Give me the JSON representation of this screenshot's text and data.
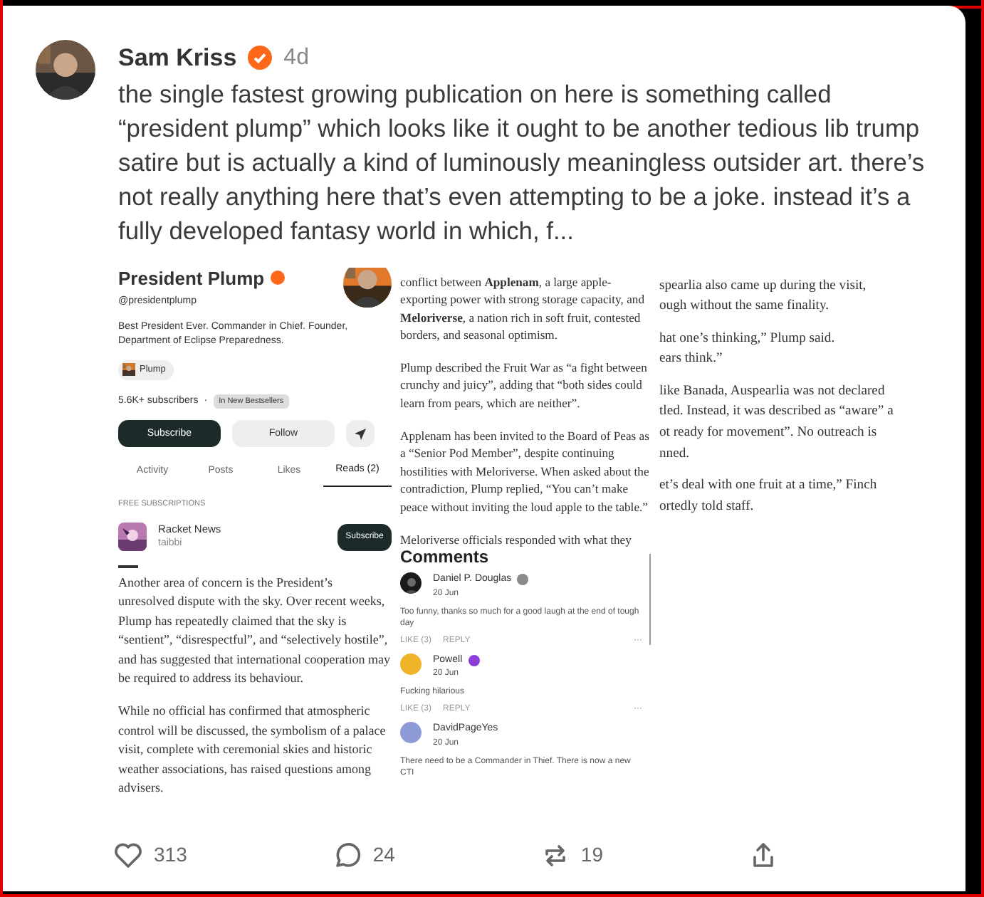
{
  "post": {
    "author": "Sam Kriss",
    "verified": true,
    "time": "4d",
    "text": "the single fastest growing publication on here is something called “president plump” which looks like it ought to be another tedious lib trump satire but is actually a kind of luminously meaningless outsider art. there’s not really anything here that’s even attempting to be a joke. instead it’s a fully developed fantasy world in which, f..."
  },
  "attachment": {
    "profile": {
      "name": "President Plump",
      "verified": true,
      "handle": "@presidentplump",
      "bio": "Best President Ever. Commander in Chief. Founder, Department of Eclipse Preparedness.",
      "chip": "Plump",
      "subscribers": "5.6K+ subscribers",
      "separator": "·",
      "tag": "In New Bestsellers",
      "buttons": [
        {
          "kind": "primary",
          "label": "Subscribe"
        },
        {
          "kind": "secondary",
          "label": "Follow"
        },
        {
          "kind": "send"
        }
      ],
      "tabs": [
        {
          "label": "Activity",
          "selected": false
        },
        {
          "label": "Posts",
          "selected": false
        },
        {
          "label": "Likes",
          "selected": false
        },
        {
          "label": "Reads (2)",
          "selected": true
        }
      ],
      "section": "FREE SUBSCRIPTIONS",
      "subscription": {
        "name": "Racket News",
        "author": "taibbi",
        "button": "Subscribe"
      }
    },
    "article_left": [
      "Another area of concern is the President’s unresolved dispute with the sky. Over recent weeks, Plump has repeatedly claimed that the sky is “sentient”, “disrespectful”, and “selectively hostile”, and has suggested that international cooperation may be required to address its behaviour.",
      "While no official has confirmed that atmospheric control will be discussed, the symbolism of a palace visit, complete with ceremonial skies and historic weather associations, has raised questions among advisers."
    ],
    "article_middle": [
      "conflict between **Applenam**, a large apple-exporting power with strong storage capacity, and **Meloriverse**, a nation rich in soft fruit, contested borders, and seasonal optimism.",
      "Plump described the Fruit War as “a fight between crunchy and juicy”, adding that “both sides could learn from pears, which are neither”.",
      "Applenam has been invited to the Board of Peas as a “Senior Pod Member”, despite continuing hostilities with Meloriverse. When asked about the contradiction, Plump replied, “You can’t make peace without inviting the loud apple to the table.”",
      "Meloriverse officials responded with what they"
    ],
    "comments": {
      "title": "Comments",
      "items": [
        {
          "author": "Daniel P. Douglas",
          "color": "#8a8a8a",
          "date": "20 Jun",
          "text": "Too funny, thanks so much for a good laugh at the end of tough day",
          "like": "LIKE (3)",
          "reply": "REPLY",
          "more": "···"
        },
        {
          "author": "Powell",
          "color": "#8b3fd9",
          "avatar": {
            "kind": "plain",
            "color": "#f0b429"
          },
          "date": "20 Jun",
          "text": "Fucking hilarious",
          "like": "LIKE (3)",
          "reply": "REPLY",
          "more": "···"
        },
        {
          "author": "DavidPageYes",
          "avatar": {
            "kind": "plain",
            "color": "#8e9ad6"
          },
          "date": "20 Jun",
          "text": "There need to be a Commander in Thief. There is now a new CTI"
        }
      ]
    },
    "article_right": [
      [
        "spearlia also came up during the visit,",
        "ough without the same finality."
      ],
      [
        "hat one’s thinking,” Plump said.",
        "ears think.”"
      ],
      [
        "like Banada, Auspearlia was not declared",
        "tled. Instead, it was described as “aware” a",
        "ot ready for movement”. No outreach is",
        "nned."
      ],
      [
        "et’s deal with one fruit at a time,” Finch",
        "ortedly told staff."
      ]
    ]
  },
  "actions": [
    {
      "kind": "like",
      "count": "313"
    },
    {
      "kind": "comment",
      "count": "24"
    },
    {
      "kind": "restack",
      "count": "19"
    },
    {
      "kind": "share"
    }
  ]
}
